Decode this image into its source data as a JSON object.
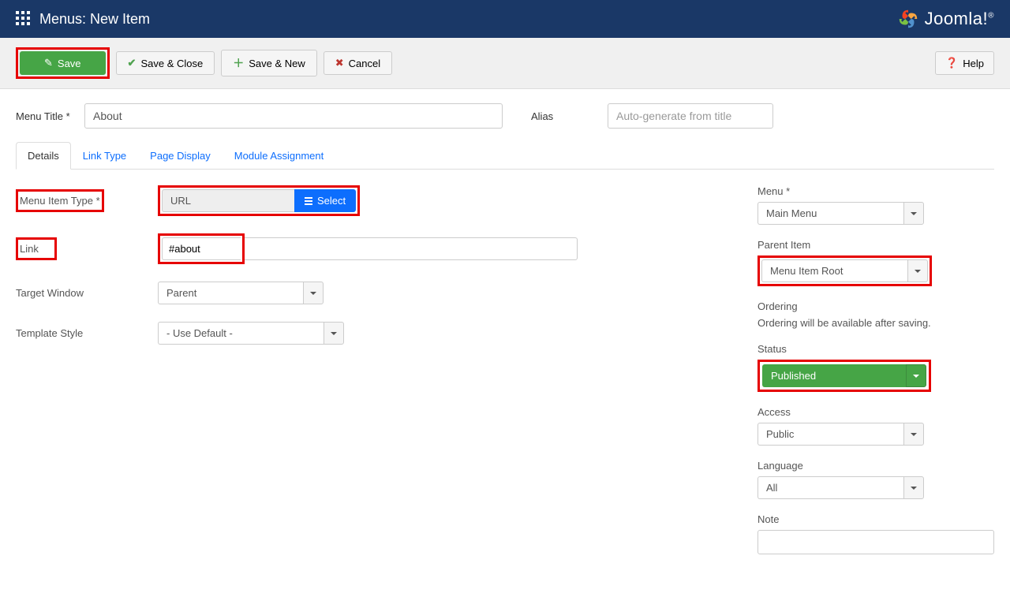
{
  "header": {
    "title": "Menus: New Item",
    "logo_text": "Joomla!"
  },
  "toolbar": {
    "save": "Save",
    "save_close": "Save & Close",
    "save_new": "Save & New",
    "cancel": "Cancel",
    "help": "Help"
  },
  "title_row": {
    "menu_title_label": "Menu Title *",
    "menu_title_value": "About",
    "alias_label": "Alias",
    "alias_placeholder": "Auto-generate from title"
  },
  "tabs": {
    "details": "Details",
    "link_type": "Link Type",
    "page_display": "Page Display",
    "module_assignment": "Module Assignment"
  },
  "form": {
    "menu_item_type_label": "Menu Item Type *",
    "menu_item_type_value": "URL",
    "select_btn": "Select",
    "link_label": "Link",
    "link_value": "#about",
    "target_window_label": "Target Window",
    "target_window_value": "Parent",
    "template_style_label": "Template Style",
    "template_style_value": "- Use Default -"
  },
  "sidebar": {
    "menu_label": "Menu *",
    "menu_value": "Main Menu",
    "parent_label": "Parent Item",
    "parent_value": "Menu Item Root",
    "ordering_label": "Ordering",
    "ordering_text": "Ordering will be available after saving.",
    "status_label": "Status",
    "status_value": "Published",
    "access_label": "Access",
    "access_value": "Public",
    "language_label": "Language",
    "language_value": "All",
    "note_label": "Note"
  }
}
